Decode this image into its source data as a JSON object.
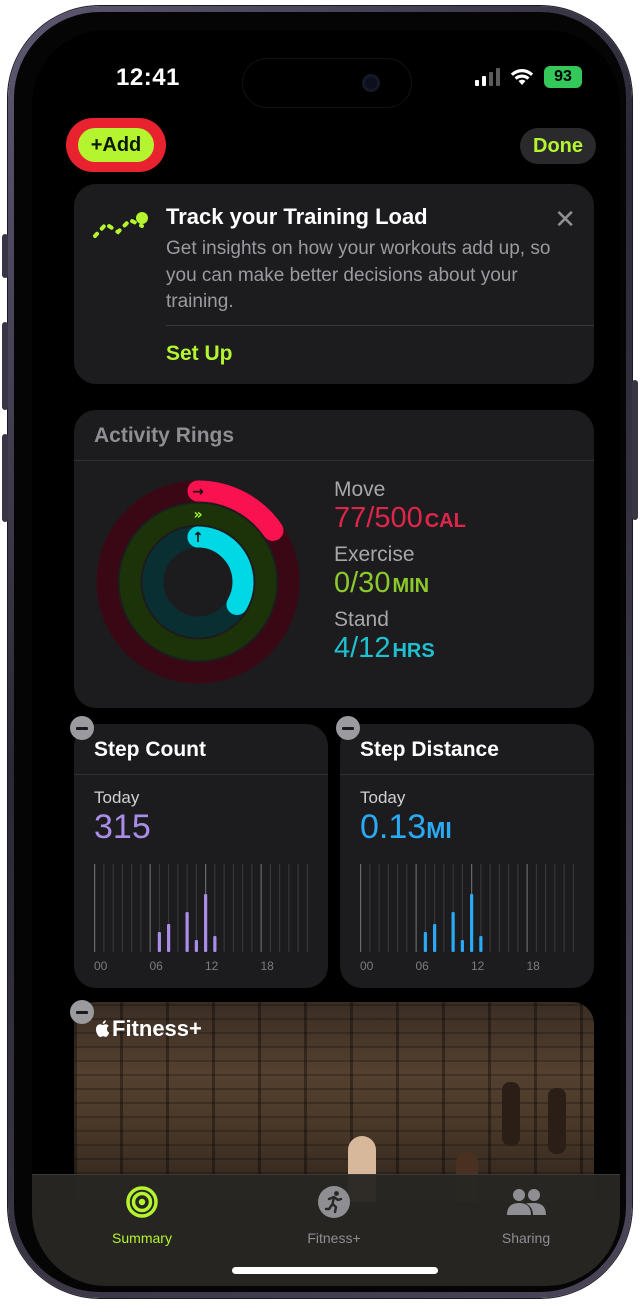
{
  "status_bar": {
    "time": "12:41",
    "battery": "93",
    "signal_icon": "cellular-signal-icon",
    "wifi_icon": "wifi-icon"
  },
  "toolbar": {
    "add_label": "+Add",
    "done_label": "Done"
  },
  "training_card": {
    "title": "Track your Training Load",
    "body": "Get insights on how your workouts add up, so you can make better decisions about your training.",
    "action": "Set Up",
    "icon": "training-load-icon"
  },
  "activity": {
    "title": "Activity Rings",
    "move": {
      "label": "Move",
      "value": "77/500",
      "unit": "CAL",
      "fraction": 0.154
    },
    "exercise": {
      "label": "Exercise",
      "value": "0/30",
      "unit": "MIN",
      "fraction": 0.0
    },
    "stand": {
      "label": "Stand",
      "value": "4/12",
      "unit": "HRS",
      "fraction": 0.333
    },
    "colors": {
      "move": "#fa114f",
      "exercise": "#a3f93a",
      "stand": "#00d8e6"
    }
  },
  "step_count": {
    "title": "Step Count",
    "period": "Today",
    "value": "315",
    "ticks": [
      "00",
      "06",
      "12",
      "18"
    ]
  },
  "step_distance": {
    "title": "Step Distance",
    "period": "Today",
    "value": "0.13",
    "unit": "MI",
    "ticks": [
      "00",
      "06",
      "12",
      "18"
    ]
  },
  "fitness_plus": {
    "logo": "Fitness+"
  },
  "tabbar": {
    "summary": "Summary",
    "fitness": "Fitness+",
    "sharing": "Sharing"
  },
  "colors": {
    "accent": "#b4f530",
    "steps": "#a98de8",
    "distance": "#2aa9f5",
    "highlight": "#e8232f"
  }
}
